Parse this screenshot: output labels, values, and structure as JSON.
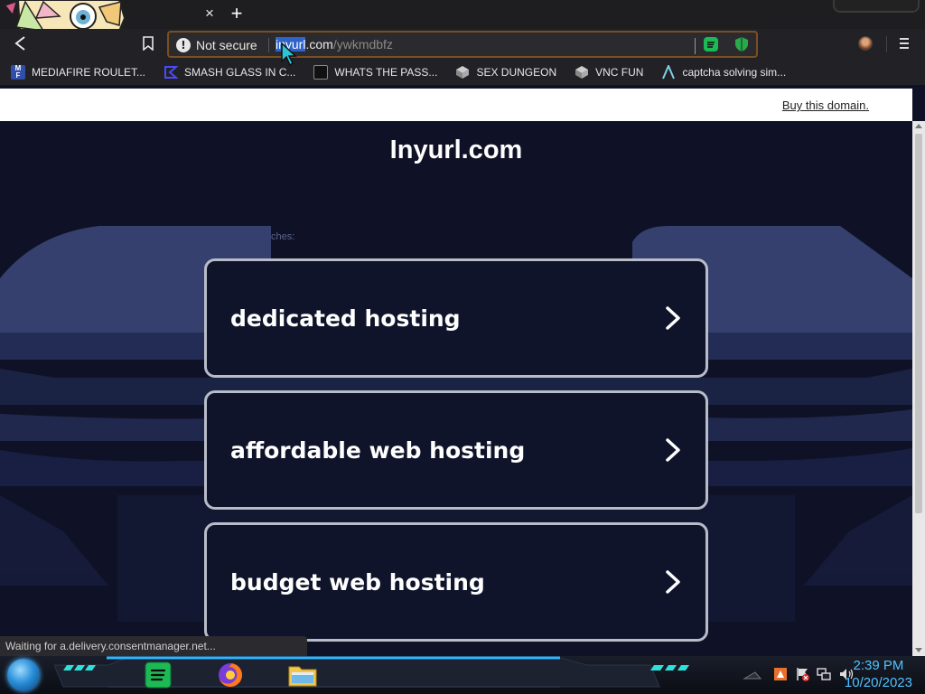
{
  "tabs": {
    "close_glyph": "×",
    "new_glyph": "+"
  },
  "toolbar": {
    "security_label": "Not secure",
    "url_host_selected": "inyurl",
    "url_host_rest": ".com",
    "url_path": "/ywkmdbfz"
  },
  "bookmarks": [
    {
      "label": "MEDIAFIRE ROULET...",
      "icon": "mediafire-icon",
      "color": "#2f4fa8"
    },
    {
      "label": "SMASH GLASS IN C...",
      "icon": "smash-icon",
      "color": "#3a3ad8"
    },
    {
      "label": "WHATS THE PASS...",
      "icon": "pass-icon",
      "color": "#111111"
    },
    {
      "label": "SEX DUNGEON",
      "icon": "dungeon-icon",
      "color": "#bbbbbb"
    },
    {
      "label": "VNC FUN",
      "icon": "vnc-icon",
      "color": "#bbbbbb"
    },
    {
      "label": "captcha solving sim...",
      "icon": "captcha-icon",
      "color": "#7fd0e8"
    }
  ],
  "page": {
    "buy_link": "Buy this domain.",
    "site_title": "Inyurl.com",
    "related_label": "ches:",
    "cards": [
      {
        "label": "dedicated hosting"
      },
      {
        "label": "affordable web hosting"
      },
      {
        "label": "budget web hosting"
      }
    ]
  },
  "status": {
    "text": "Waiting for a.delivery.consentmanager.net..."
  },
  "taskbar": {
    "time": "2:39 PM",
    "date": "10/20/2023",
    "apps": [
      "spotify-app",
      "firefox-app",
      "file-explorer-app"
    ]
  },
  "colors": {
    "accent": "#4fc3ff",
    "page_bg": "#0f1226",
    "card_border": "#b8bcc8",
    "omnibox_border": "#7a4f22"
  }
}
